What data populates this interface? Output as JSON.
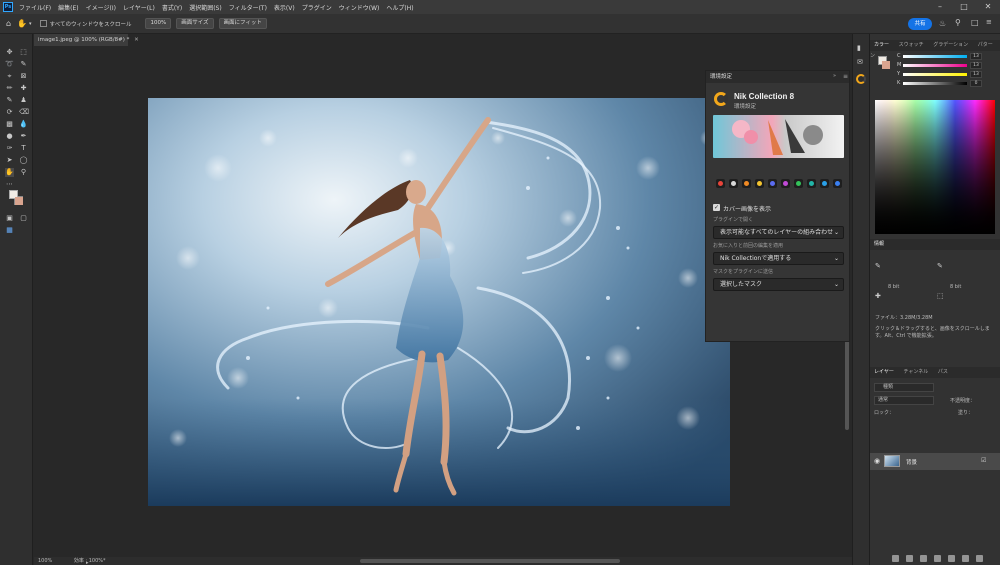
{
  "menu": {
    "app_icon": "Ps",
    "items": [
      "ファイル(F)",
      "編集(E)",
      "イメージ(I)",
      "レイヤー(L)",
      "書式(Y)",
      "選択範囲(S)",
      "フィルター(T)",
      "表示(V)",
      "プラグイン",
      "ウィンドウ(W)",
      "ヘルプ(H)"
    ]
  },
  "options_bar": {
    "scroll_all_label": "すべてのウィンドウをスクロール",
    "zoom_100": "100%",
    "fit_screen": "画面サイズ",
    "fill_screen": "画面にフィット",
    "share_label": "共有"
  },
  "document": {
    "tab_title": "image1.jpeg @ 100% (RGB/8#) *",
    "status_zoom": "100%",
    "status_info": "効率 : 100%*"
  },
  "plugin_panel": {
    "header": "環境設定",
    "title": "Nik Collection 8",
    "subtitle": "環境設定",
    "show_cover_label": "カバー画像を表示",
    "open_plugin_label": "プラグインで開く",
    "open_plugin_value": "表示可能なすべてのレイヤーの組み合わせ",
    "apply_label": "お気に入りと前回の編集を適用",
    "apply_value": "Nik Collectionで適用する",
    "mask_label": "マスクをプラグインに送信",
    "mask_value": "選択したマスク",
    "plugin_icons": [
      {
        "name": "color-efex-icon",
        "color": "#e8443a"
      },
      {
        "name": "silver-efex-icon",
        "color": "#d9d9d9"
      },
      {
        "name": "analog-efex-icon",
        "color": "#f08a24"
      },
      {
        "name": "viveza-icon",
        "color": "#f4c430"
      },
      {
        "name": "dfine-icon",
        "color": "#5b6cf0"
      },
      {
        "name": "sharpener-icon",
        "color": "#c04ad6"
      },
      {
        "name": "hdr-efex-icon",
        "color": "#34c25a"
      },
      {
        "name": "perspective-efex-icon",
        "color": "#22b5a8"
      },
      {
        "name": "presharpener-icon",
        "color": "#2aa0e8"
      },
      {
        "name": "nik-extra-icon",
        "color": "#3a7ff0"
      }
    ]
  },
  "right_panel": {
    "color_tabs": [
      "カラー",
      "スウォッチ",
      "グラデーション",
      "パターン"
    ],
    "sliders": [
      {
        "label": "C",
        "value": "13"
      },
      {
        "label": "M",
        "value": "13"
      },
      {
        "label": "Y",
        "value": "13"
      },
      {
        "label": "K",
        "value": "0"
      }
    ],
    "info_tab": "情報",
    "info_bit_left": "8 bit",
    "info_bit_right": "8 bit",
    "info_file": "ファイル：3.28M/3.28M",
    "info_hint": "クリック＆ドラッグすると、画像をスクロールします。Alt、Ctrl で機能拡張。",
    "layer_tabs": [
      "レイヤー",
      "チャンネル",
      "パス"
    ],
    "layer_search": "種類",
    "blend_mode": "通常",
    "opacity_label": "不透明度：",
    "fill_label": "塗り：",
    "lock_label": "ロック：",
    "layer_name": "背景"
  }
}
